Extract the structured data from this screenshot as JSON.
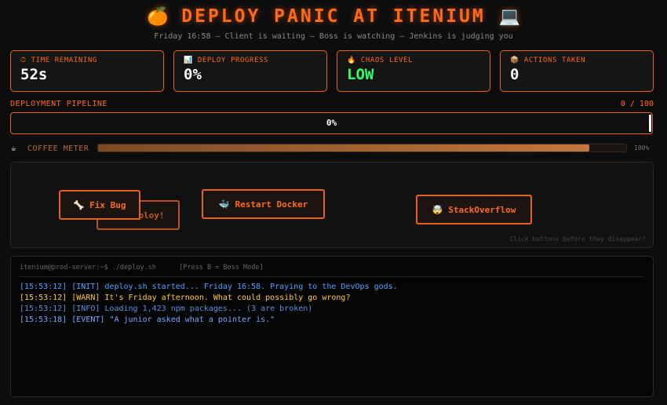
{
  "header": {
    "title_icon_left": "🍊",
    "title": "DEPLOY PANIC AT ITENIUM",
    "title_icon_right": "💻",
    "subtitle": "Friday 16:58 — Client is waiting — Boss is watching — Jenkins is judging you"
  },
  "stats": [
    {
      "icon": "⏱",
      "label": "TIME REMAINING",
      "value": "52s"
    },
    {
      "icon": "📊",
      "label": "DEPLOY PROGRESS",
      "value": "0%"
    },
    {
      "icon": "🔥",
      "label": "CHAOS LEVEL",
      "value": "LOW"
    },
    {
      "icon": "📦",
      "label": "ACTIONS TAKEN",
      "value": "0"
    }
  ],
  "pipeline": {
    "label": "DEPLOYMENT PIPELINE",
    "count": "0 / 100",
    "percent_text": "0%",
    "progress": 0
  },
  "coffee": {
    "icon": "☕",
    "label": "COFFEE METER",
    "percent_text": "100%",
    "level": 0.93
  },
  "actions": {
    "buttons": [
      {
        "icon": "🚀",
        "label": "Deploy!"
      },
      {
        "icon": "🦴",
        "label": "Fix Bug"
      },
      {
        "icon": "🐳",
        "label": "Restart Docker"
      },
      {
        "icon": "🤯",
        "label": "StackOverflow"
      }
    ],
    "hint": "Click buttons before they disappear!"
  },
  "terminal": {
    "prompt": "itenium@prod-server:~$ ./deploy.sh",
    "hint": "[Press B = Boss Mode]",
    "lines": [
      {
        "time": "[15:53:12]",
        "tag": "[INIT]",
        "text": "deploy.sh started... Friday 16:58. Praying to the DevOps gods.",
        "kind": "init"
      },
      {
        "time": "[15:53:12]",
        "tag": "[WARN]",
        "text": "It's Friday afternoon. What could possibly go wrong?",
        "kind": "warn"
      },
      {
        "time": "[15:53:12]",
        "tag": "[INFO]",
        "text": "Loading 1,423 npm packages... (3 are broken)",
        "kind": "info"
      },
      {
        "time": "[15:53:18]",
        "tag": "[EVENT]",
        "text": "\"A junior asked what a pointer is.\"",
        "kind": "event"
      }
    ]
  },
  "colors": {
    "accent": "#ff6a1a",
    "chaos_low": "#33ff66",
    "warn": "#ffcc33",
    "info": "#5a9dff"
  }
}
